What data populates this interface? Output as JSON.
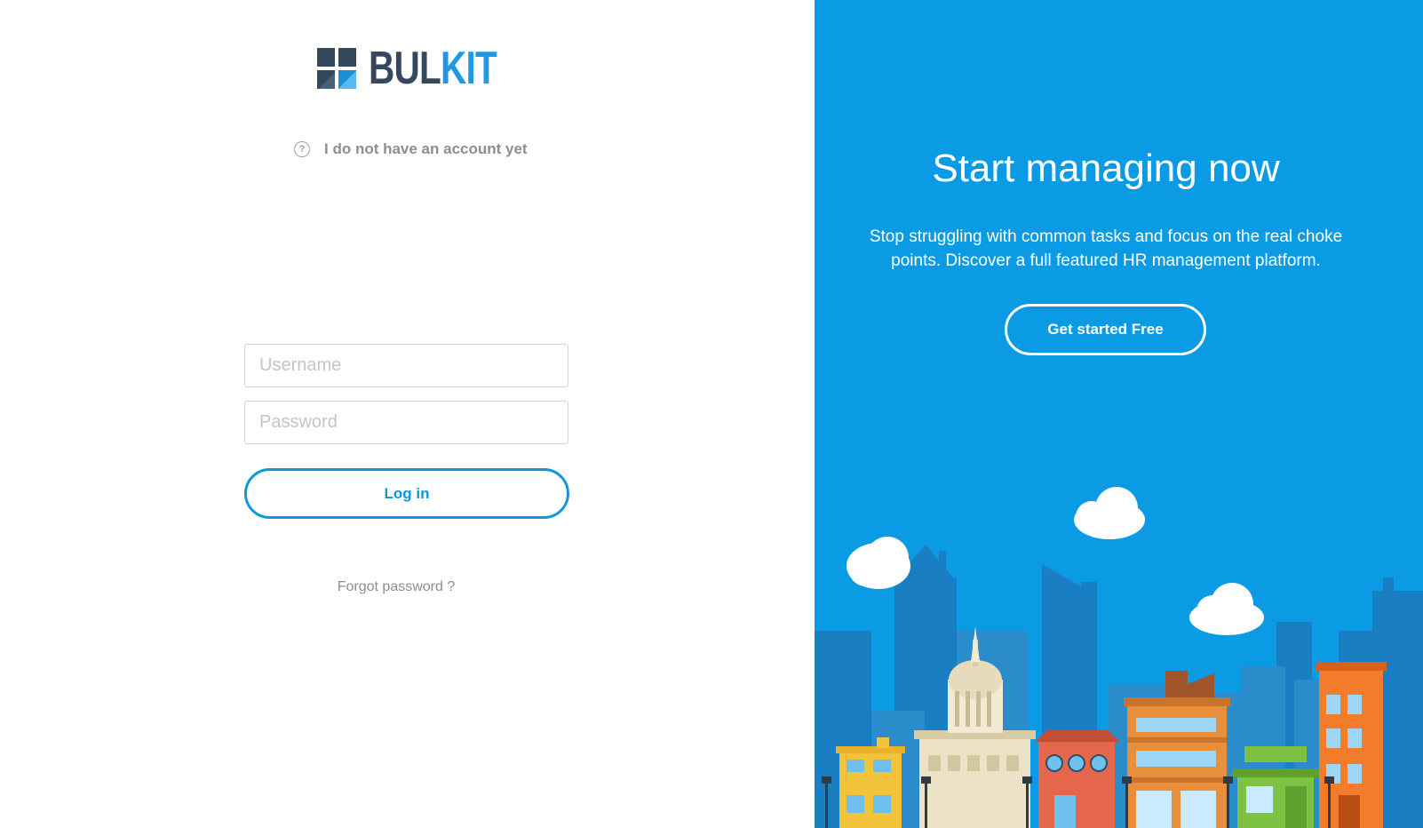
{
  "brand": {
    "logo_part1": "BUL",
    "logo_part2": "KIT",
    "colors": {
      "dark": "#34495e",
      "accent": "#1e9ae5"
    }
  },
  "signup_link": {
    "icon": "question-circle-icon",
    "label": "I do not have an account yet"
  },
  "login_form": {
    "username_placeholder": "Username",
    "password_placeholder": "Password",
    "login_button": "Log in",
    "forgot_link": "Forgot password ?"
  },
  "promo": {
    "title": "Start managing now",
    "description": "Stop struggling with common tasks and focus on the real choke points. Discover a full featured HR management platform.",
    "cta_button": "Get started Free",
    "background_color": "#0b9be4"
  }
}
